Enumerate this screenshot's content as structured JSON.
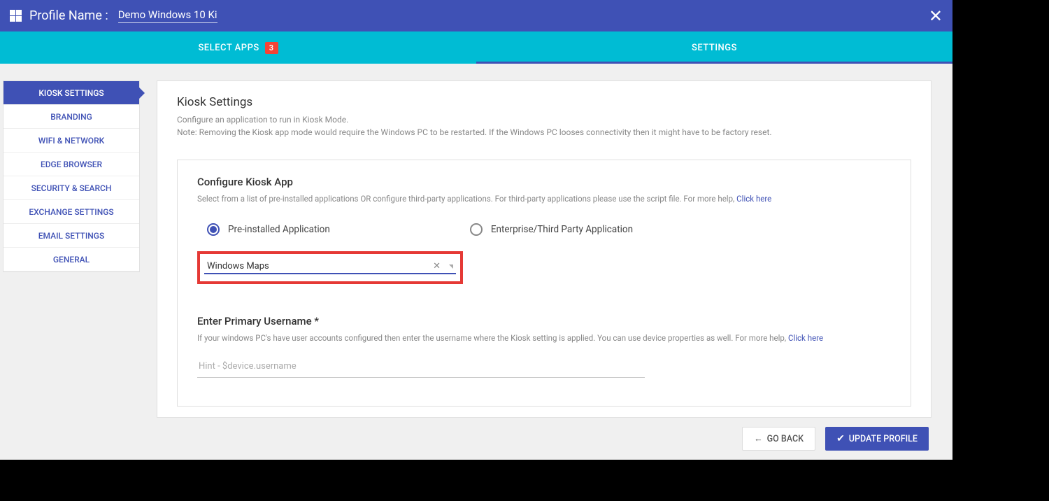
{
  "header": {
    "profile_label": "Profile Name :",
    "profile_name": "Demo Windows 10 Ki"
  },
  "tabs": {
    "select_apps": "SELECT APPS",
    "select_apps_badge": "3",
    "settings": "SETTINGS"
  },
  "sidebar": {
    "items": [
      {
        "label": "KIOSK SETTINGS",
        "active": true
      },
      {
        "label": "BRANDING",
        "active": false
      },
      {
        "label": "WIFI & NETWORK",
        "active": false
      },
      {
        "label": "EDGE BROWSER",
        "active": false
      },
      {
        "label": "SECURITY & SEARCH",
        "active": false
      },
      {
        "label": "EXCHANGE SETTINGS",
        "active": false
      },
      {
        "label": "EMAIL SETTINGS",
        "active": false
      },
      {
        "label": "GENERAL",
        "active": false
      }
    ]
  },
  "main": {
    "title": "Kiosk Settings",
    "sub1": "Configure an application to run in Kiosk Mode.",
    "sub2": "Note: Removing the Kiosk app mode would require the Windows PC to be restarted. If the Windows PC looses connectivity then it might have to be factory reset.",
    "panel": {
      "title": "Configure Kiosk App",
      "desc": "Select from a list of pre-installed applications OR configure third-party applications. For third-party applications please use the script file. For more help, ",
      "desc_link": "Click here",
      "radio1": "Pre-installed Application",
      "radio2": "Enterprise/Third Party Application",
      "select_value": "Windows Maps",
      "username_title": "Enter Primary Username *",
      "username_desc": "If your windows PC's have user accounts configured then enter the username where the Kiosk setting is applied. You can use device properties as well. For more help, ",
      "username_link": "Click here",
      "username_placeholder": "Hint - $device.username"
    }
  },
  "footer": {
    "back": "GO BACK",
    "update": "UPDATE PROFILE"
  }
}
